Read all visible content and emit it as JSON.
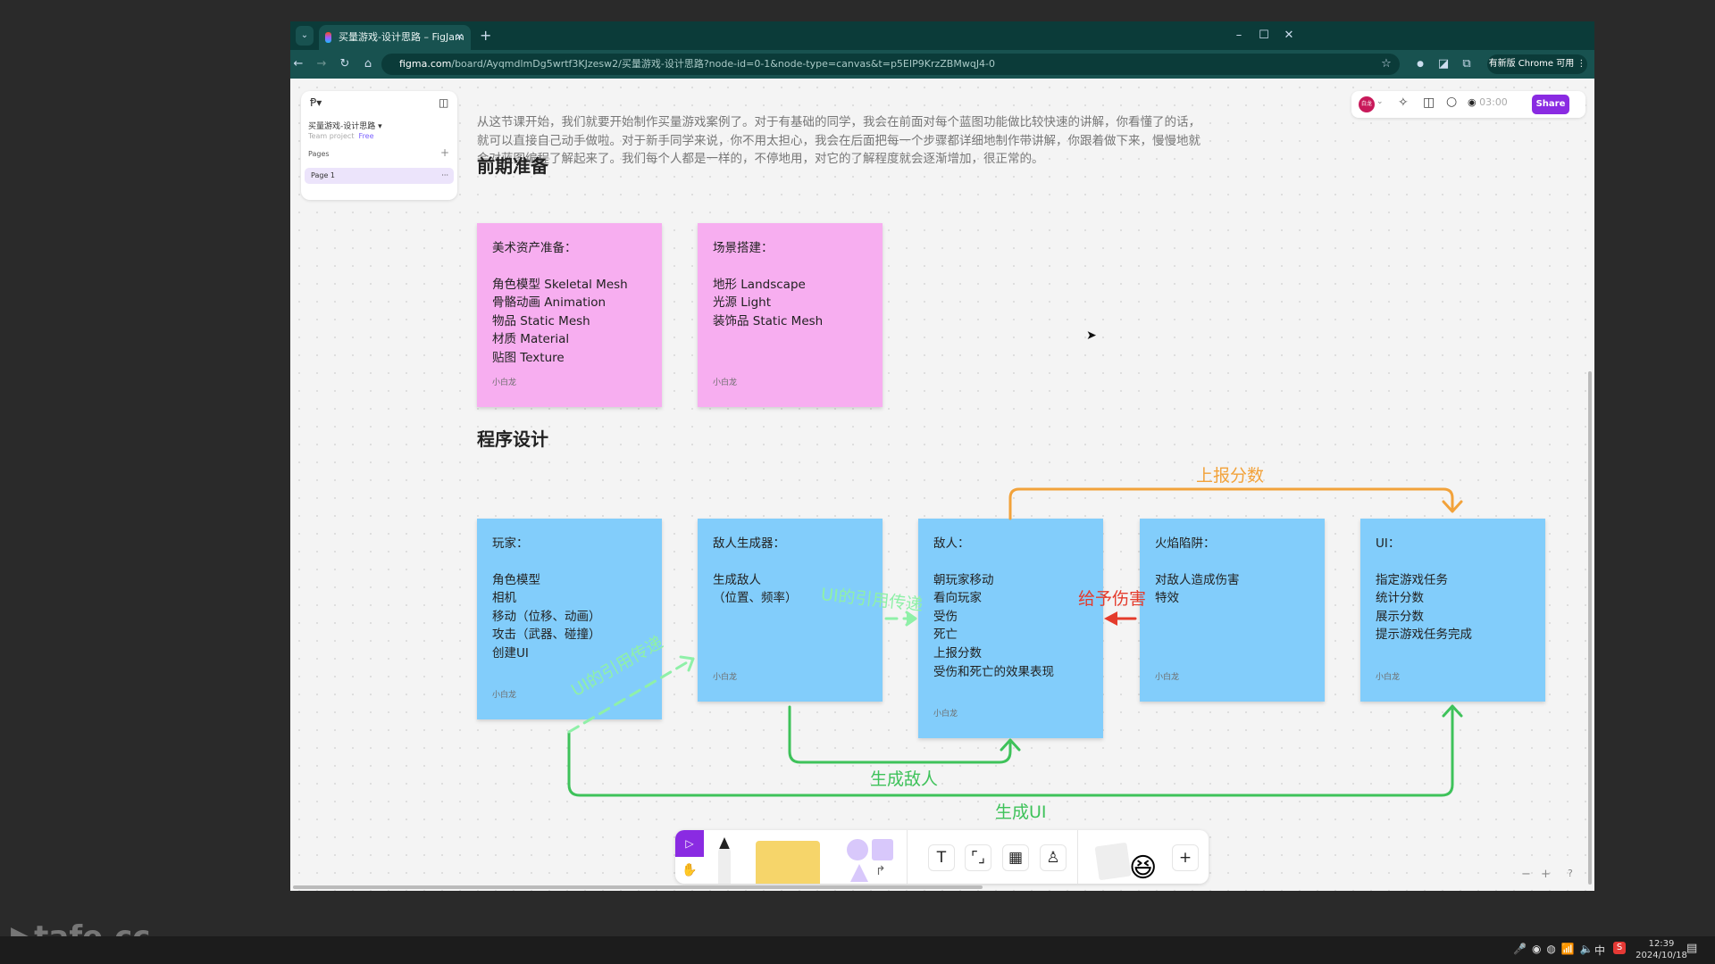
{
  "browser": {
    "tab_title": "买量游戏-设计思路 – FigJam",
    "url_host": "figma.com",
    "url_rest": "/board/AyqmdlmDg5wrtf3KJzesw2/买量游戏-设计思路?node-id=0-1&node-type=canvas&t=p5EIP9KrzZBMwqJ4-0",
    "update_label": "有新版 Chrome 可用"
  },
  "sidebar": {
    "file_name": "买量游戏-设计思路",
    "team": "Team project",
    "plan": "Free",
    "pages_label": "Pages",
    "page": "Page 1"
  },
  "topbar": {
    "avatar": "白龙",
    "timer": "03:00",
    "share": "Share"
  },
  "intro": "从这节课开始，我们就要开始制作买量游戏案例了。对于有基础的同学，我会在前面对每个蓝图功能做比较快速的讲解，你看懂了的话，就可以直接自己动手做啦。对于新手同学来说，你不用太担心，我会在后面把每一个步骤都详细地制作带讲解，你跟着做下来，慢慢地就会对蓝图编程了解起来了。我们每个人都是一样的，不停地用，对它的了解程度就会逐渐增加，很正常的。",
  "sections": {
    "prep": "前期准备",
    "design": "程序设计"
  },
  "prep_notes": [
    {
      "title": "美术资产准备：",
      "lines": [
        "角色模型 Skeletal Mesh",
        "骨骼动画 Animation",
        "物品 Static Mesh",
        "材质 Material",
        "贴图 Texture"
      ],
      "author": "小白龙"
    },
    {
      "title": "场景搭建：",
      "lines": [
        "地形 Landscape",
        "光源 Light",
        "装饰品 Static Mesh"
      ],
      "author": "小白龙"
    }
  ],
  "design_notes": [
    {
      "title": "玩家：",
      "lines": [
        "角色模型",
        "相机",
        "移动（位移、动画）",
        "攻击（武器、碰撞）",
        "创建UI"
      ],
      "author": "小白龙"
    },
    {
      "title": "敌人生成器：",
      "lines": [
        "生成敌人",
        "（位置、频率）"
      ],
      "author": "小白龙"
    },
    {
      "title": "敌人：",
      "lines": [
        "朝玩家移动",
        "看向玩家",
        "受伤",
        "死亡",
        "上报分数",
        "受伤和死亡的效果表现"
      ],
      "author": "小白龙"
    },
    {
      "title": "火焰陷阱：",
      "lines": [
        "对敌人造成伤害",
        "特效"
      ],
      "author": "小白龙"
    },
    {
      "title": "UI：",
      "lines": [
        "指定游戏任务",
        "统计分数",
        "展示分数",
        "提示游戏任务完成"
      ],
      "author": "小白龙"
    }
  ],
  "connectors": {
    "report_score": "上报分数",
    "spawn_enemy": "生成敌人",
    "spawn_ui": "生成UI",
    "ui_ref_1": "UI的引用传递",
    "ui_ref_2": "UI的引用传递",
    "damage": "给予伤害"
  },
  "colors": {
    "orange": "#f2a23a",
    "green": "#3ec25a",
    "light_green": "#8ff0a8",
    "red": "#e43b2c",
    "pink_note": "#f7aef0",
    "blue_note": "#82cdfb",
    "share": "#8a2be2"
  },
  "taskbar": {
    "time": "12:39",
    "date": "2024/10/18",
    "ime": "中"
  },
  "watermark": "tafe.cc"
}
